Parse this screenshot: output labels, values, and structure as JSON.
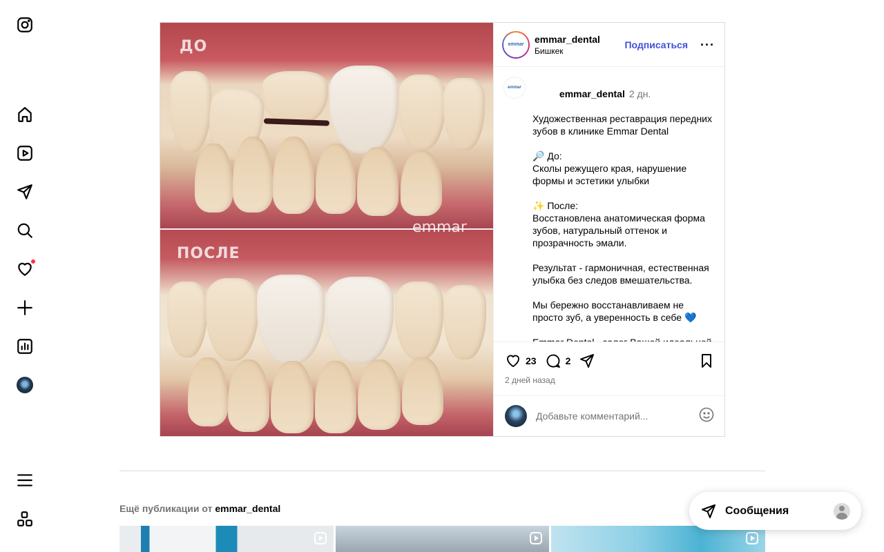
{
  "nav": {
    "icons": [
      "instagram-icon",
      "home-icon",
      "reels-icon",
      "direct-icon",
      "search-icon",
      "notifications-icon",
      "create-icon",
      "insights-icon",
      "profile-avatar",
      "menu-icon",
      "more-apps-icon"
    ],
    "notification_dot_color": "#ff3040"
  },
  "post": {
    "media": {
      "label_before": "ДО",
      "label_after": "ПОСЛЕ",
      "watermark": "emmar"
    },
    "author": {
      "username": "emmar_dental",
      "location": "Бишкек",
      "avatar_text": "emmar"
    },
    "follow_label": "Подписаться",
    "more_label": "···",
    "caption": {
      "username": "emmar_dental",
      "time": "2 дн.",
      "lines": [
        "Художественная реставрация передних зубов в клинике Emmar Dental",
        "",
        "🔎 До:",
        "Сколы режущего края, нарушение формы и эстетики улыбки",
        "",
        "✨ После:",
        "Восстановлена анатомическая форма зубов, натуральный оттенок и прозрачность эмали.",
        "",
        "Результат - гармоничная, естественная улыбка без следов вмешательства.",
        "",
        "Мы бережно восстанавливаем не просто зуб, а уверенность в себе 💙",
        "",
        "Emmar Dental - залог Вашей идеальной улыбки"
      ]
    },
    "likes": "23",
    "comments": "2",
    "posted_ago": "2 дней назад",
    "comment_placeholder": "Добавьте комментарий..."
  },
  "more_posts": {
    "prefix": "Ещё публикации от",
    "username": "emmar_dental"
  },
  "messages": {
    "label": "Сообщения"
  },
  "colors": {
    "accent": "#3f51d8",
    "muted": "#737373",
    "border": "#dbdbdb"
  }
}
